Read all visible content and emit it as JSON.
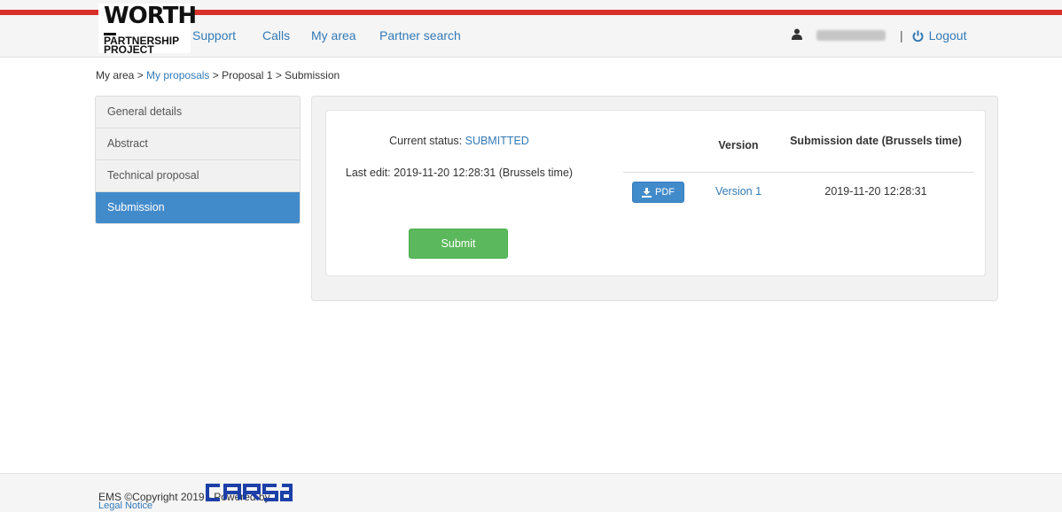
{
  "header": {
    "logo": {
      "line1": "WORTH",
      "line2": "PARTNERSHIP",
      "line3": "PROJECT"
    },
    "nav": [
      "Support",
      "Calls",
      "My area",
      "Partner search"
    ],
    "user": {
      "icon": "user-icon",
      "separator": "|",
      "logout_label": "Logout",
      "logout_icon": "power-icon"
    }
  },
  "breadcrumb": {
    "item1": "My area",
    "sep": " > ",
    "item2": "My proposals",
    "item3": "Proposal 1",
    "item4": "Submission"
  },
  "sidebar": {
    "items": [
      {
        "label": "General details",
        "active": false
      },
      {
        "label": "Abstract",
        "active": false
      },
      {
        "label": "Technical proposal",
        "active": false
      },
      {
        "label": "Submission",
        "active": true
      }
    ]
  },
  "submission": {
    "status_label": "Current status:",
    "status_value": "SUBMITTED",
    "last_edit": "Last edit: 2019-11-20 12:28:31 (Brussels time)",
    "submit_label": "Submit"
  },
  "versions_table": {
    "headers": {
      "version": "Version",
      "date": "Submission date (Brussels time)"
    },
    "rows": [
      {
        "pdf_label": "PDF",
        "version": "Version 1",
        "date": "2019-11-20 12:28:31"
      }
    ]
  },
  "footer": {
    "copyright": "EMS ©Copyright 2019 - Powered by",
    "legal": "Legal Notice",
    "brand": "carsa"
  },
  "colors": {
    "accent": "#428bca",
    "link": "#337ab7",
    "success": "#5cb85c",
    "brand_red": "#d9302b",
    "carsa_blue": "#1c3fa8"
  }
}
